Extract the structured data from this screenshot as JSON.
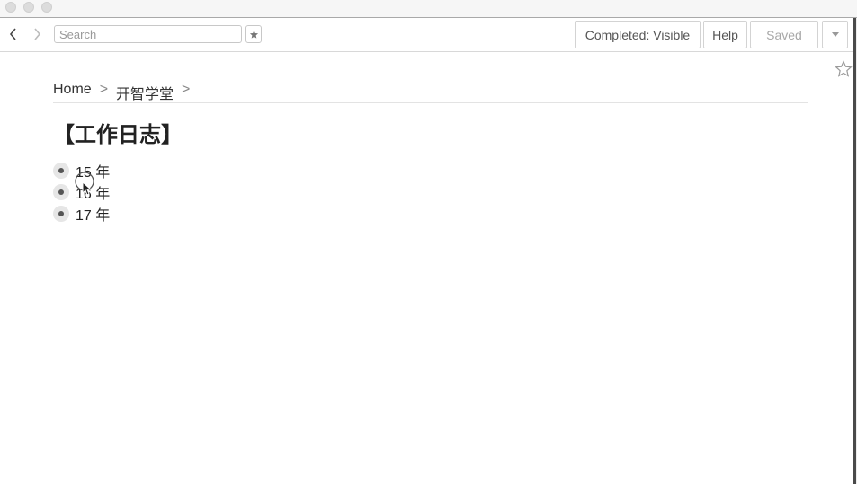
{
  "toolbar": {
    "search_placeholder": "Search",
    "completed_label": "Completed: Visible",
    "help_label": "Help",
    "saved_label": "Saved"
  },
  "breadcrumb": {
    "items": [
      "Home",
      "开智学堂"
    ],
    "separator": ">"
  },
  "page": {
    "title": "【工作日志】",
    "items": [
      {
        "label": "15 年"
      },
      {
        "label": "16 年"
      },
      {
        "label": "17 年"
      }
    ]
  },
  "icons": {
    "back": "chevron-left-icon",
    "forward": "chevron-right-icon",
    "favorite": "star-icon",
    "dropdown": "caret-down-icon",
    "page_star": "star-outline-icon"
  },
  "colors": {
    "background": "#ffffff",
    "bullet_ring": "#e6e6e6",
    "bullet_dot": "#555555",
    "saved_text": "#a8a8a8"
  }
}
